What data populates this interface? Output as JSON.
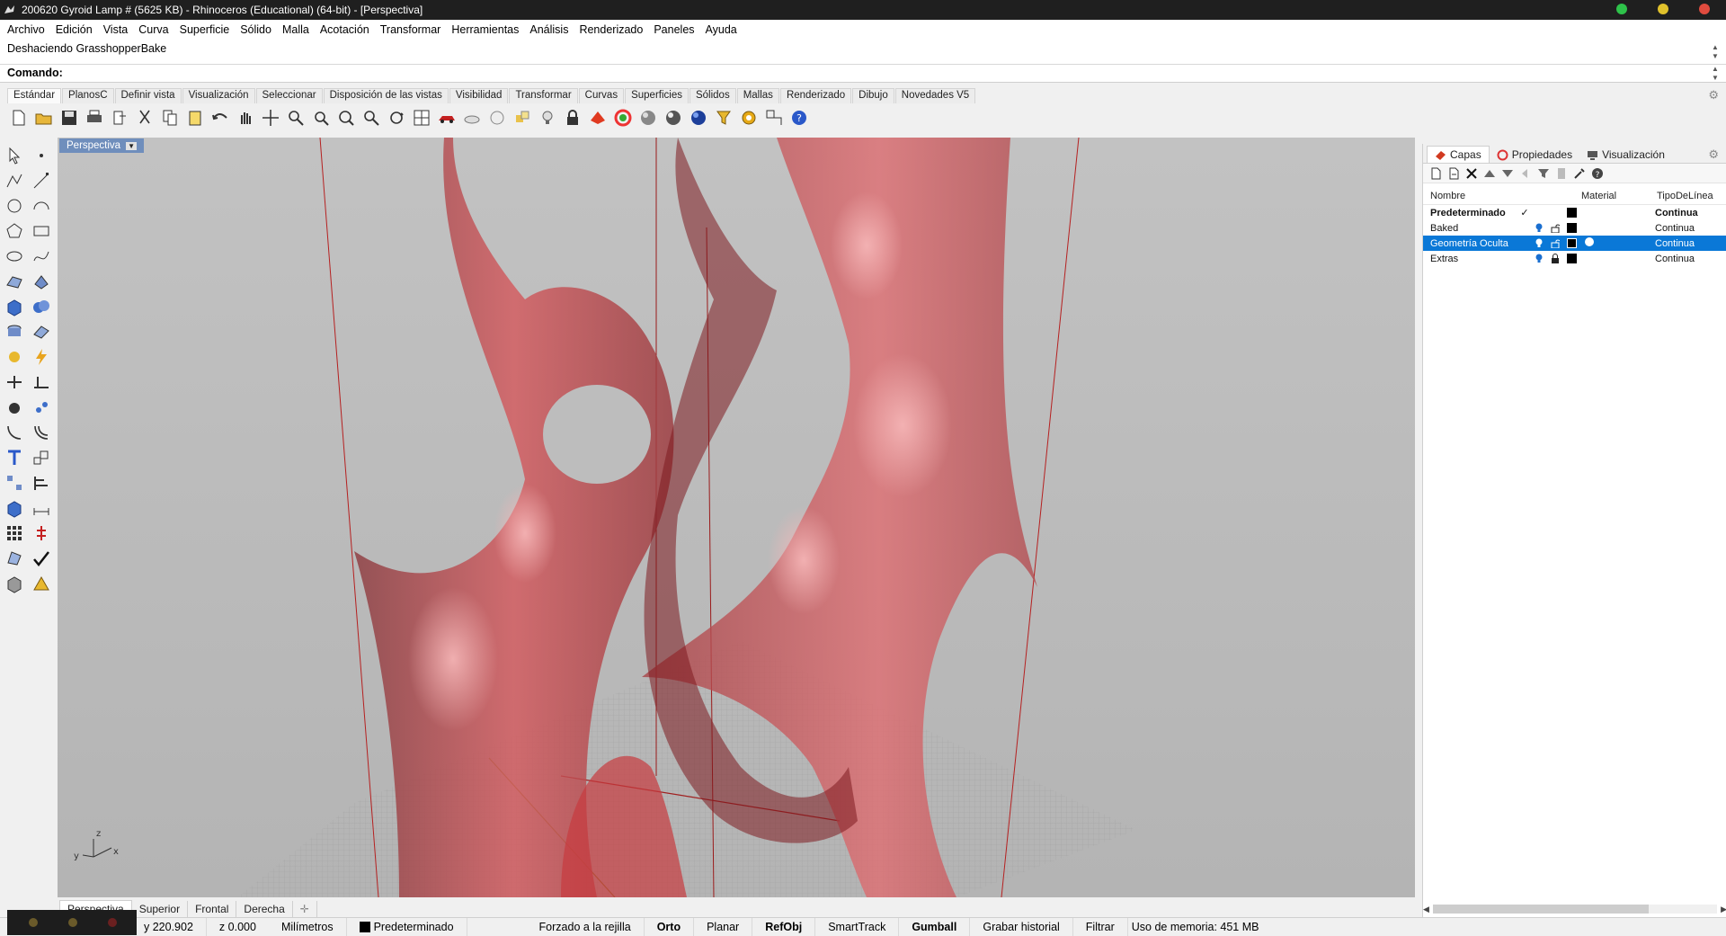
{
  "window": {
    "title": "200620 Gyroid Lamp # (5625 KB) - Rhinoceros (Educational) (64-bit) - [Perspectiva]",
    "controls": [
      "#2ec24a",
      "#e0c12c",
      "#e04b3e"
    ]
  },
  "menu": [
    "Archivo",
    "Edición",
    "Vista",
    "Curva",
    "Superficie",
    "Sólido",
    "Malla",
    "Acotación",
    "Transformar",
    "Herramientas",
    "Análisis",
    "Renderizado",
    "Paneles",
    "Ayuda"
  ],
  "command": {
    "history": "Deshaciendo GrasshopperBake",
    "label": "Comando:",
    "value": ""
  },
  "toolbar_tabs": [
    "Estándar",
    "PlanosC",
    "Definir vista",
    "Visualización",
    "Seleccionar",
    "Disposición de las vistas",
    "Visibilidad",
    "Transformar",
    "Curvas",
    "Superficies",
    "Sólidos",
    "Mallas",
    "Renderizado",
    "Dibujo",
    "Novedades V5"
  ],
  "toolbar_icons": [
    "new-file-icon",
    "open-icon",
    "save-icon",
    "print-icon",
    "import-icon",
    "cut-icon",
    "copy-icon",
    "paste-icon",
    "undo-icon",
    "pan-icon",
    "move-view-icon",
    "zoom-icon",
    "zoom-window-icon",
    "zoom-extents-icon",
    "zoom-selected-icon",
    "rotate-view-icon",
    "viewport-layout-icon",
    "car-icon",
    "named-view-icon",
    "cplane-icon",
    "select-icon",
    "light-icon",
    "lock-icon",
    "render-icon",
    "color-wheel-icon",
    "shaded-sphere-icon",
    "rendered-sphere-icon",
    "blue-sphere-icon",
    "filter-icon",
    "options-gear-icon",
    "snap-icon",
    "help-icon"
  ],
  "viewport": {
    "name": "Perspectiva",
    "axis": {
      "x": "x",
      "y": "y",
      "z": "z"
    }
  },
  "view_tabs": [
    "Perspectiva",
    "Superior",
    "Frontal",
    "Derecha"
  ],
  "panel": {
    "tabs": [
      "Capas",
      "Propiedades",
      "Visualización"
    ],
    "columns": {
      "name": "Nombre",
      "material": "Material",
      "linetype": "TipoDeLínea"
    },
    "layers": [
      {
        "name": "Predeterminado",
        "current": "✓",
        "color": "#000000",
        "linetype": "Continua",
        "locked": false,
        "default": true,
        "selected": false
      },
      {
        "name": "Baked",
        "current": "",
        "color": "#000000",
        "linetype": "Continua",
        "locked": false,
        "default": false,
        "selected": false
      },
      {
        "name": "Geometría Oculta",
        "current": "",
        "color": "#000000",
        "linetype": "Continua",
        "locked": false,
        "default": false,
        "selected": true
      },
      {
        "name": "Extras",
        "current": "",
        "color": "#000000",
        "linetype": "Continua",
        "locked": true,
        "default": false,
        "selected": false
      }
    ]
  },
  "status": {
    "y": "y 220.902",
    "z": "z 0.000",
    "units": "Milímetros",
    "layer": "Predeterminado",
    "items": [
      "Forzado a la rejilla",
      "Orto",
      "Planar",
      "RefObj",
      "SmartTrack",
      "Gumball",
      "Grabar historial",
      "Filtrar"
    ],
    "bold_items": [
      "Orto",
      "RefObj",
      "Gumball"
    ],
    "memory": "Uso de memoria: 451 MB"
  }
}
